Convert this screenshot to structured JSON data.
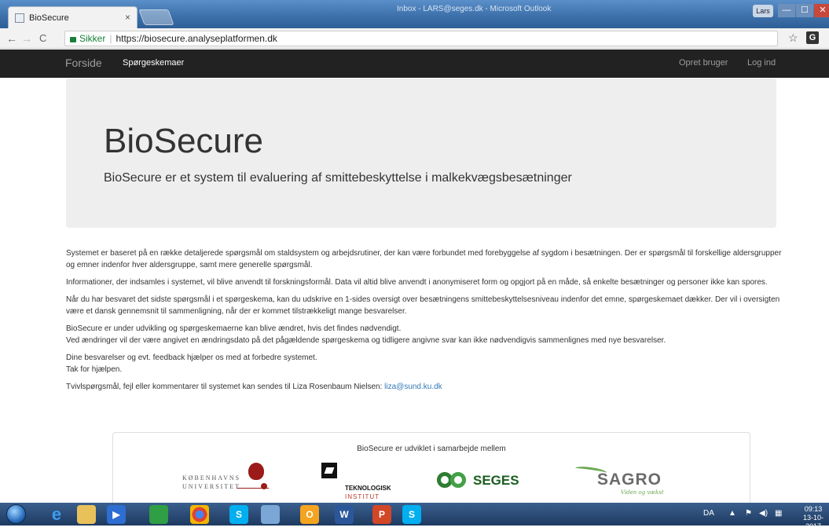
{
  "browser": {
    "tab_title": "BioSecure",
    "tab_close": "×",
    "background_window_title": "Inbox - LARS@seges.dk - Microsoft Outlook",
    "user_badge": "Lars",
    "window_min": "—",
    "window_max": "☐",
    "window_close": "✕",
    "back": "←",
    "forward": "→",
    "reload": "C",
    "secure_label": "Sikker",
    "url": "https://biosecure.analyseplatformen.dk",
    "star": "☆",
    "extension_label": "G"
  },
  "navbar": {
    "brand": "Forside",
    "left_links": [
      "Spørgeskemaer"
    ],
    "right_links": [
      "Opret bruger",
      "Log ind"
    ]
  },
  "jumbotron": {
    "title": "BioSecure",
    "subtitle": "BioSecure er et system til evaluering af smittebeskyttelse i malkekvægsbesætninger"
  },
  "content": {
    "p1": "Systemet er baseret på en række detaljerede spørgsmål om staldsystem og arbejdsrutiner, der kan være forbundet med forebyggelse af sygdom i besætningen. Der er spørgsmål til forskellige aldersgrupper og emner indenfor hver aldersgruppe, samt mere generelle spørgsmål.",
    "p2": "Informationer, der indsamles i systemet, vil blive anvendt til forskningsformål. Data vil altid blive anvendt i anonymiseret form og opgjort på en måde, så enkelte besætninger og personer ikke kan spores.",
    "p3": "Når du har besvaret det sidste spørgsmål i et spørgeskema, kan du udskrive en 1-sides oversigt over besætningens smittebeskyttelsesniveau indenfor det emne, spørgeskemaet dækker. Der vil i oversigten være et dansk gennemsnit til sammenligning, når der er kommet tilstrækkeligt mange besvarelser.",
    "p4_line1": "BioSecure er under udvikling og spørgeskemaerne kan blive ændret, hvis det findes nødvendigt.",
    "p4_line2": "Ved ændringer vil der være angivet en ændringsdato på det pågældende spørgeskema og tidligere angivne svar kan ikke nødvendigvis sammenlignes med nye besvarelser.",
    "p5_line1": "Dine besvarelser og evt. feedback hjælper os med at forbedre systemet.",
    "p5_line2": "Tak for hjælpen.",
    "p6_text": "Tvivlspørgsmål, fejl eller kommentarer til systemet kan sendes til Liza Rosenbaum Nielsen: ",
    "p6_email": "liza@sund.ku.dk"
  },
  "partners": {
    "title": "BioSecure er udviklet i samarbejde mellem",
    "ku_line1": "KØBENHAVNS",
    "ku_line2": "UNIVERSITET",
    "ti_line1": "TEKNOLOGISK",
    "ti_line2": "INSTITUT",
    "seges": "SEGES",
    "sagro": "SAGRO",
    "sagro_tagline": "Viden og vækst"
  },
  "taskbar": {
    "apps": [
      "internet-explorer",
      "file-explorer",
      "media-player",
      "app-green",
      "chrome",
      "skype-red",
      "app-network",
      "outlook",
      "word",
      "powerpoint",
      "skype"
    ],
    "language": "DA",
    "time": "09:13",
    "date": "13-10-2017"
  },
  "colors": {
    "navbar_bg": "#222222",
    "jumbotron_bg": "#eeeeee",
    "link": "#337ab7"
  }
}
